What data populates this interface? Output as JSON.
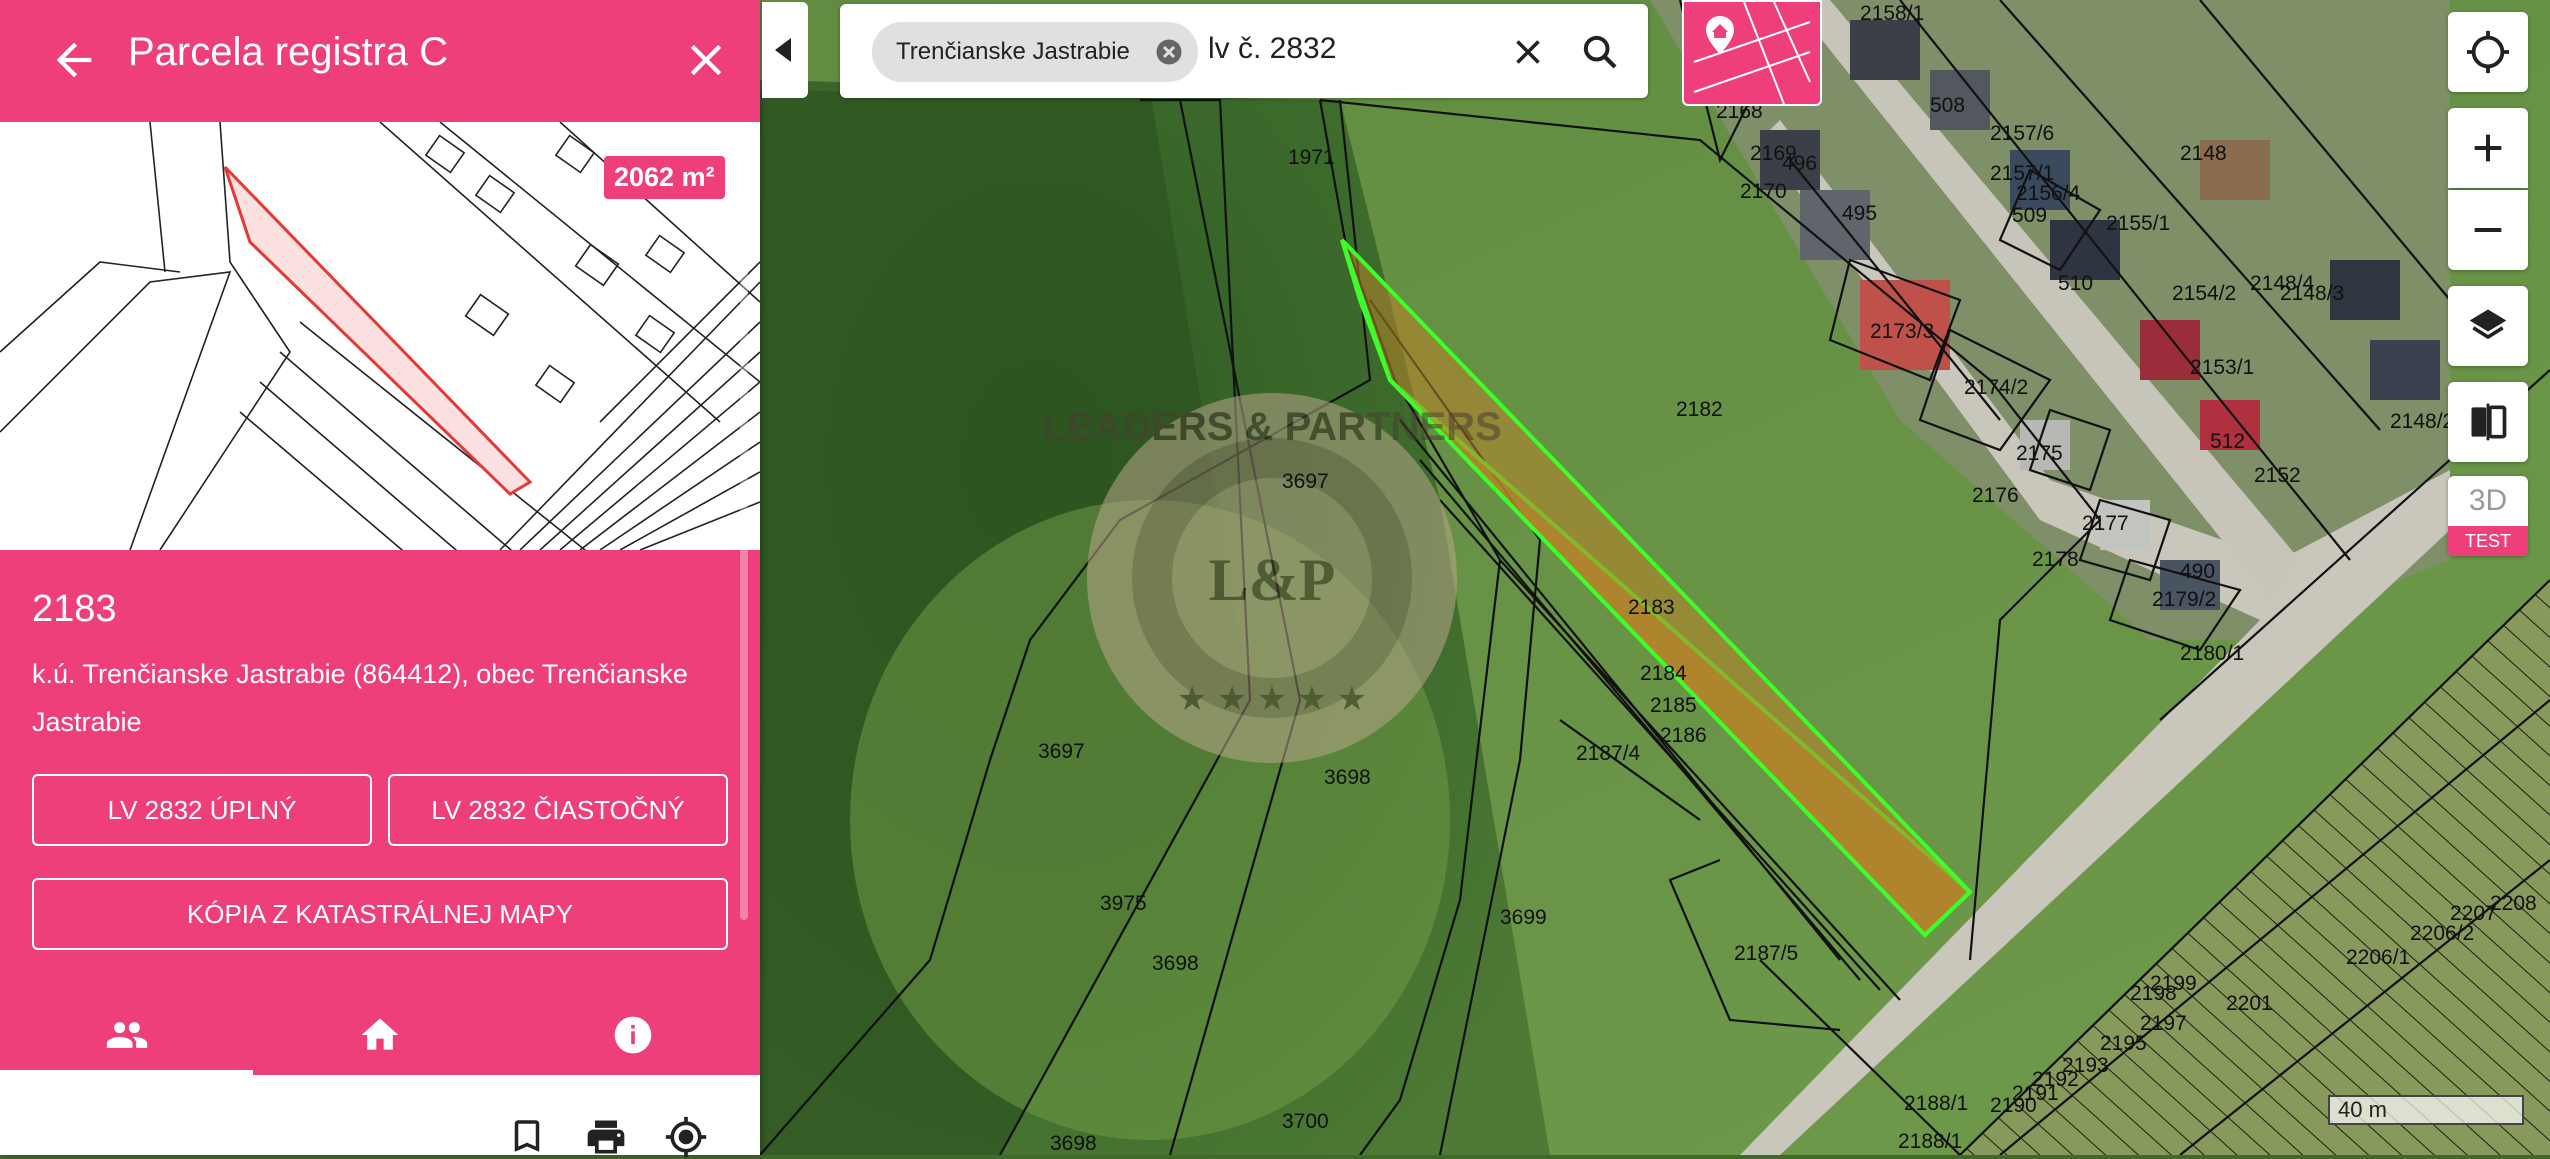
{
  "panel": {
    "title": "Parcela registra C",
    "area_badge": "2062 m²",
    "parcel_number": "2183",
    "address": "k.ú. Trenčianske Jastrabie (864412), obec Trenčianske Jastrabie",
    "buttons": {
      "lv_full": "LV 2832 ÚPLNÝ",
      "lv_partial": "LV 2832 ČIASTOČNÝ",
      "map_copy": "KÓPIA Z KATASTRÁLNEJ MAPY"
    },
    "tabs": [
      "owners",
      "home",
      "info"
    ],
    "active_tab": "owners",
    "bottom_icons": [
      "bookmark-icon",
      "print-icon",
      "locate-icon"
    ]
  },
  "search": {
    "chip_label": "Trenčianske Jastrabie",
    "query": "lv č. 2832"
  },
  "controls": {
    "three_d": "3D",
    "test": "TEST"
  },
  "scale_label": "40 m",
  "watermark": "LEADERS & PARTNERS",
  "map_labels": {
    "p1971": "1971",
    "p2168": "2168",
    "p2170": "2170",
    "p2158_1": "2158/1",
    "p508": "508",
    "p2157_6": "2157/6",
    "p2157_1": "2157/1",
    "p496": "496",
    "p2169": "2169",
    "p495": "495",
    "p2156_4": "2156/4",
    "p509": "509",
    "p2155_1": "2155/1",
    "p2148": "2148",
    "p510": "510",
    "p2154_2": "2154/2",
    "p2148_4": "2148/4",
    "p2148_3": "2148/3",
    "p2173_3": "2173/3",
    "p2174_2": "2174/2",
    "p2153_1": "2153/1",
    "p2182": "2182",
    "p2148_2": "2148/2",
    "p512": "512",
    "p2175": "2175",
    "p2152": "2152",
    "p2176": "2176",
    "p2177": "2177",
    "p2178": "2178",
    "p490": "490",
    "p2179_2": "2179/2",
    "p2180_1": "2180/1",
    "p3697a": "3697",
    "p2183": "2183",
    "p3697b": "3697",
    "p2184": "2184",
    "p2185": "2185",
    "p2186": "2186",
    "p2187_4": "2187/4",
    "p3698a": "3698",
    "p3699": "3699",
    "p2187_5": "2187/5",
    "p3698b": "3698",
    "p3975": "3975",
    "p2206_1": "2206/1",
    "p2206_2": "2206/2",
    "p2207": "2207",
    "p2208": "2208",
    "p2201": "2201",
    "p2199": "2199",
    "p2198": "2198",
    "p2197": "2197",
    "p2195": "2195",
    "p2193": "2193",
    "p2192": "2192",
    "p2191": "2191",
    "p2190": "2190",
    "p2188_1a": "2188/1",
    "p2188_1b": "2188/1",
    "p3698c": "3698",
    "p3700": "3700"
  },
  "colors": {
    "accent": "#ee3f7c",
    "parcel_outline": "#3cff2a",
    "parcel_fill": "#b9822a",
    "thumb_parcel": "#e53935"
  }
}
